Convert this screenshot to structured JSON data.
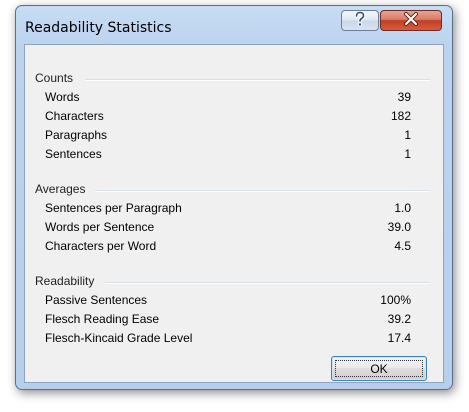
{
  "window": {
    "title": "Readability Statistics"
  },
  "titlebar": {
    "help_icon": "question-mark-icon",
    "close_icon": "close-x-icon"
  },
  "sections": {
    "counts": {
      "header": "Counts",
      "rows": [
        {
          "label": "Words",
          "value": "39"
        },
        {
          "label": "Characters",
          "value": "182"
        },
        {
          "label": "Paragraphs",
          "value": "1"
        },
        {
          "label": "Sentences",
          "value": "1"
        }
      ]
    },
    "averages": {
      "header": "Averages",
      "rows": [
        {
          "label": "Sentences per Paragraph",
          "value": "1.0"
        },
        {
          "label": "Words per Sentence",
          "value": "39.0"
        },
        {
          "label": "Characters per Word",
          "value": "4.5"
        }
      ]
    },
    "readability": {
      "header": "Readability",
      "rows": [
        {
          "label": "Passive Sentences",
          "value": "100%"
        },
        {
          "label": "Flesch Reading Ease",
          "value": "39.2"
        },
        {
          "label": "Flesch-Kincaid Grade Level",
          "value": "17.4"
        }
      ]
    }
  },
  "buttons": {
    "ok_label": "OK"
  },
  "colors": {
    "close_button": "#c13e23",
    "frame": "#bcd3ee",
    "focus_border": "#3c7fb1"
  }
}
